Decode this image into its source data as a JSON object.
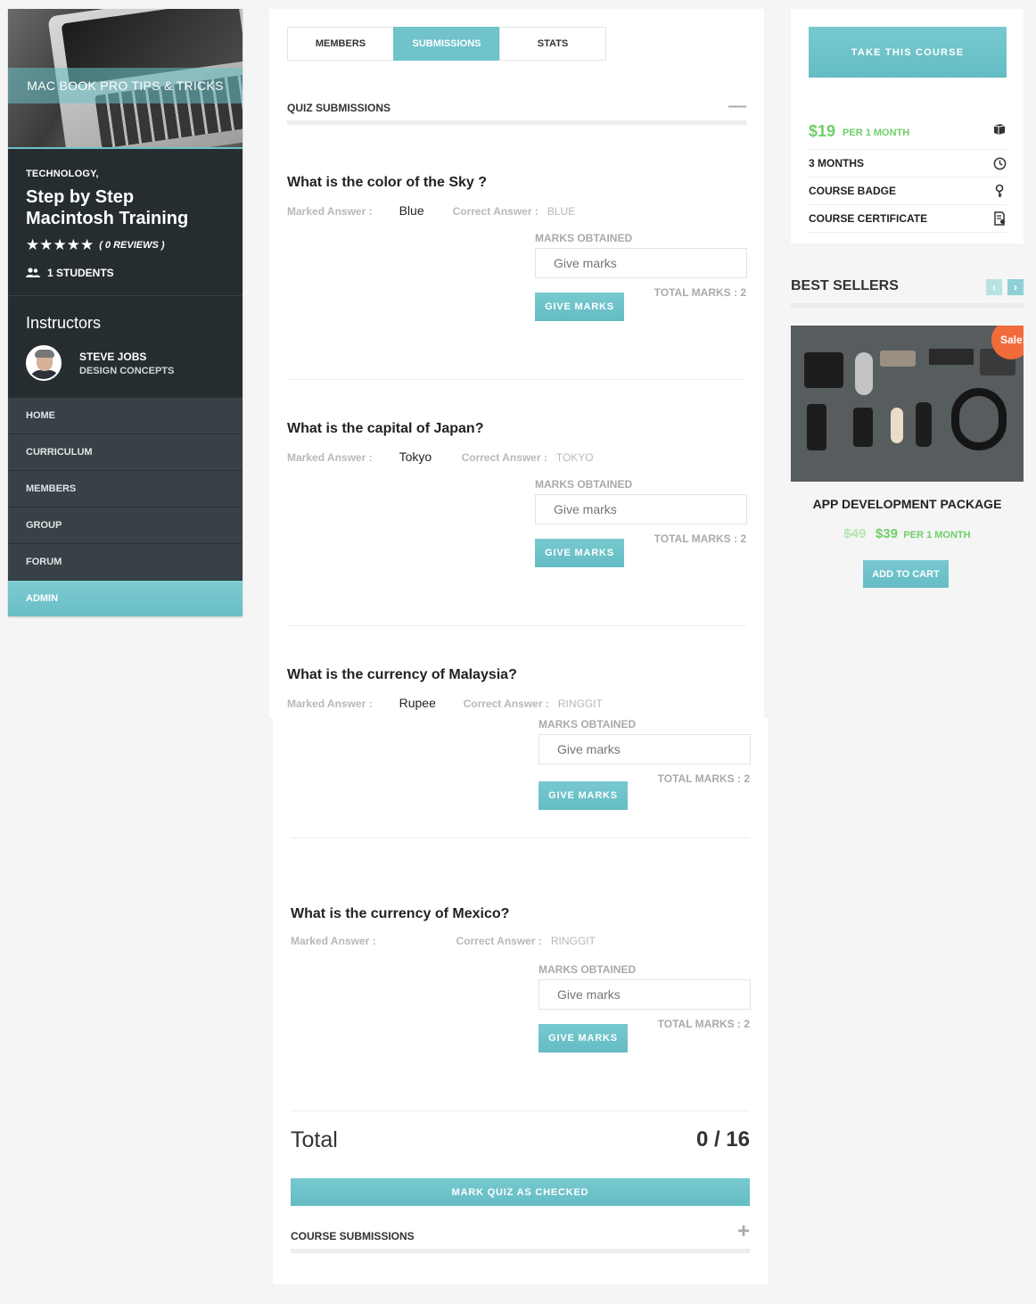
{
  "course": {
    "cover_text": "MAC BOOK PRO TIPS & TRICKS",
    "category": "TECHNOLOGY,",
    "title": "Step by Step Macintosh Training",
    "stars": "★★★★★",
    "reviews": "( 0 REVIEWS )",
    "students": "1 STUDENTS"
  },
  "instructors": {
    "heading": "Instructors",
    "items": [
      {
        "name": "STEVE JOBS",
        "subtitle": "DESIGN CONCEPTS"
      }
    ]
  },
  "nav": {
    "items": [
      {
        "label": "HOME"
      },
      {
        "label": "CURRICULUM"
      },
      {
        "label": "MEMBERS"
      },
      {
        "label": "GROUP"
      },
      {
        "label": "FORUM"
      },
      {
        "label": "ADMIN",
        "active": true
      }
    ]
  },
  "tabs": [
    {
      "label": "MEMBERS"
    },
    {
      "label": "SUBMISSIONS",
      "active": true
    },
    {
      "label": "STATS"
    }
  ],
  "quiz_section": {
    "label": "QUIZ SUBMISSIONS",
    "toggle": "—"
  },
  "labels": {
    "marked": "Marked Answer :",
    "correct": "Correct Answer :",
    "marks_obtained": "MARKS OBTAINED",
    "give_marks_placeholder": "Give marks",
    "give_marks_button": "GIVE MARKS"
  },
  "questions": [
    {
      "question": "What is the color of the Sky ?",
      "marked": "Blue",
      "correct": "BLUE",
      "total": "TOTAL MARKS : 2"
    },
    {
      "question": "What is the capital of Japan?",
      "marked": "Tokyo",
      "correct": "TOKYO",
      "total": "TOTAL MARKS : 2"
    },
    {
      "question": "What is the currency of Malaysia?",
      "marked": "Rupee",
      "correct": "RINGGIT",
      "total": "TOTAL MARKS : 2"
    },
    {
      "question": "What is the currency of Mexico?",
      "marked": "",
      "correct": "RINGGIT",
      "total": "TOTAL MARKS : 2"
    }
  ],
  "total": {
    "label": "Total",
    "value": "0 / 16"
  },
  "mark_checked_button": "MARK QUIZ AS CHECKED",
  "course_section": {
    "label": "COURSE SUBMISSIONS",
    "toggle": "+"
  },
  "pricing": {
    "take_course": "TAKE THIS COURSE",
    "price": "$19",
    "per": "PER 1 MONTH",
    "features": [
      {
        "label": "3 MONTHS",
        "icon": "clock-icon"
      },
      {
        "label": "COURSE BADGE",
        "icon": "badge-icon"
      },
      {
        "label": "COURSE CERTIFICATE",
        "icon": "certificate-icon"
      }
    ]
  },
  "best_sellers": {
    "heading": "BEST SELLERS",
    "prev": "‹",
    "next": "›",
    "product": {
      "sale": "Sale!",
      "name": "APP DEVELOPMENT PACKAGE",
      "old_price": "$49",
      "new_price": "$39",
      "per": "PER 1 MONTH",
      "add_to_cart": "ADD TO CART"
    }
  },
  "colors": {
    "accent": "#6cc1c8",
    "price_green": "#6fcf6a",
    "sidebar_dark": "#262d31",
    "sale_badge": "#f26b3a"
  }
}
